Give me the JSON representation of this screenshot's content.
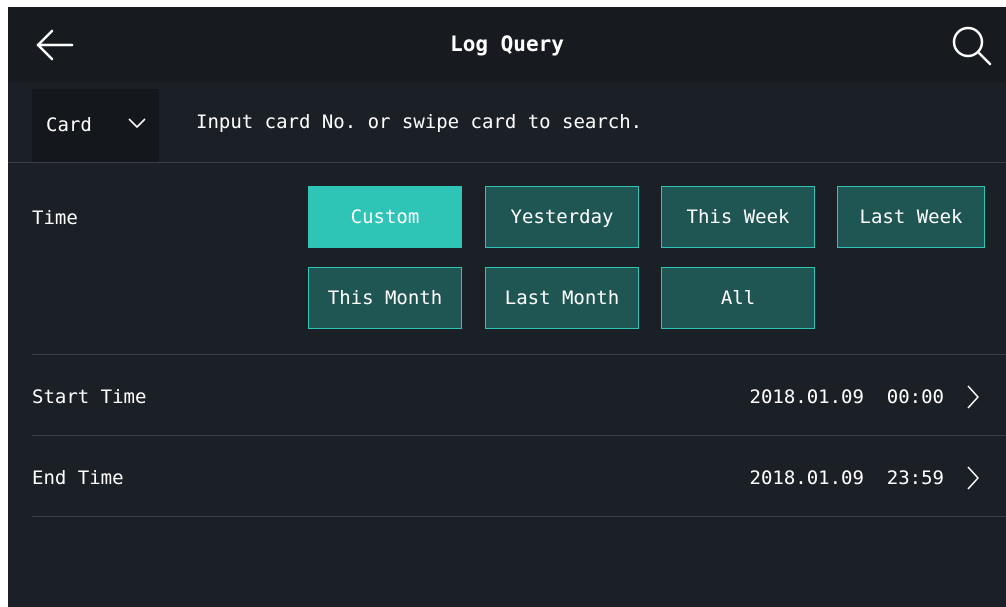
{
  "header": {
    "title": "Log Query",
    "back_icon": "arrow-left-icon",
    "search_icon": "search-icon"
  },
  "search": {
    "type_selected": "Card",
    "type_icon": "chevron-down-icon",
    "placeholder": "Input card No. or swipe card to search."
  },
  "time": {
    "label": "Time",
    "options": [
      {
        "label": "Custom",
        "selected": true
      },
      {
        "label": "Yesterday",
        "selected": false
      },
      {
        "label": "This Week",
        "selected": false
      },
      {
        "label": "Last Week",
        "selected": false
      },
      {
        "label": "This Month",
        "selected": false
      },
      {
        "label": "Last Month",
        "selected": false
      },
      {
        "label": "All",
        "selected": false
      }
    ]
  },
  "start_time": {
    "label": "Start Time",
    "value": "2018.01.09  00:00",
    "icon": "chevron-right-icon"
  },
  "end_time": {
    "label": "End Time",
    "value": "2018.01.09  23:59",
    "icon": "chevron-right-icon"
  },
  "colors": {
    "background": "#1b1f26",
    "header": "#171a1f",
    "accent": "#2ec4b6",
    "button_fill": "#1f5552",
    "divider": "#3a3f47"
  }
}
